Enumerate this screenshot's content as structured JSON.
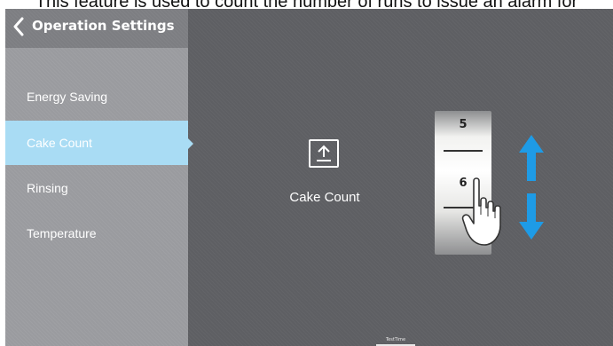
{
  "caption": "This feature is used to count the number of runs to issue an alarm for",
  "header": {
    "title": "Operation Settings"
  },
  "sidebar": {
    "items": [
      {
        "label": "Energy Saving",
        "active": false
      },
      {
        "label": "Cake Count",
        "active": true
      },
      {
        "label": "Rinsing",
        "active": false
      },
      {
        "label": "Temperature",
        "active": false
      }
    ]
  },
  "main": {
    "feature_label": "Cake Count",
    "feature_icon": "upload-arrow-icon",
    "counter": {
      "previous": "5",
      "current": "6"
    },
    "arrow_color": "#1e9be6",
    "footer_text": "TestTime"
  },
  "colors": {
    "background": "#5e5f63",
    "sidebar": "#9a9b9f",
    "active_item": "#a9dcf4"
  }
}
